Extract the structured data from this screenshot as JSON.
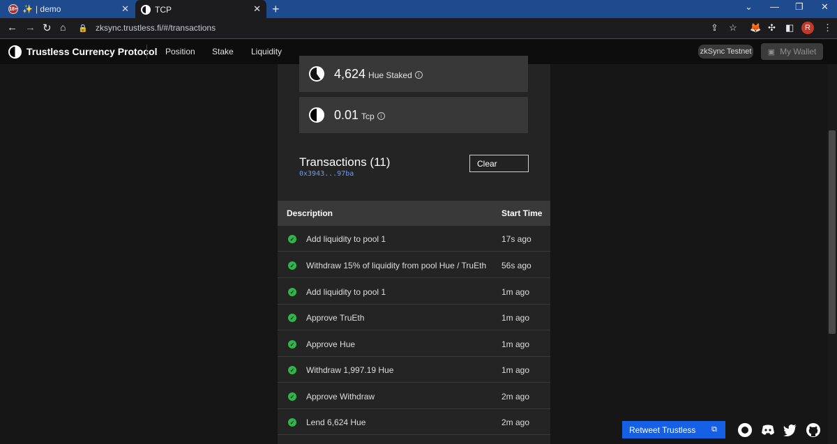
{
  "browser": {
    "tabs": [
      {
        "title": "| demo",
        "active": false
      },
      {
        "title": "TCP",
        "active": true
      }
    ],
    "url": "zksync.trustless.fi/#/transactions"
  },
  "app": {
    "brand": "Trustless Currency Protocol",
    "nav": [
      "Position",
      "Stake",
      "Liquidity"
    ],
    "network": "zkSync Testnet",
    "wallet_label": "My Wallet"
  },
  "balances": [
    {
      "value": "4,624",
      "unit": "Hue Staked",
      "icon": "hue-icon"
    },
    {
      "value": "0.01",
      "unit": "Tcp",
      "icon": "tcp-icon"
    }
  ],
  "transactions": {
    "title": "Transactions (11)",
    "address": "0x3943...97ba",
    "clear_label": "Clear",
    "headers": {
      "description": "Description",
      "start_time": "Start Time"
    },
    "rows": [
      {
        "description": "Add liquidity to pool 1",
        "time": "17s ago"
      },
      {
        "description": "Withdraw 15% of liquidity from pool Hue / TruEth",
        "time": "56s ago"
      },
      {
        "description": "Add liquidity to pool 1",
        "time": "1m ago"
      },
      {
        "description": "Approve TruEth",
        "time": "1m ago"
      },
      {
        "description": "Approve Hue",
        "time": "1m ago"
      },
      {
        "description": "Withdraw 1,997.19 Hue",
        "time": "1m ago"
      },
      {
        "description": "Approve Withdraw",
        "time": "2m ago"
      },
      {
        "description": "Lend 6,624 Hue",
        "time": "2m ago"
      }
    ]
  },
  "footer": {
    "retweet_label": "Retweet Trustless"
  },
  "colors": {
    "accent_blue": "#1660e6",
    "success_green": "#2fb548",
    "address_blue": "#6b9bff"
  }
}
